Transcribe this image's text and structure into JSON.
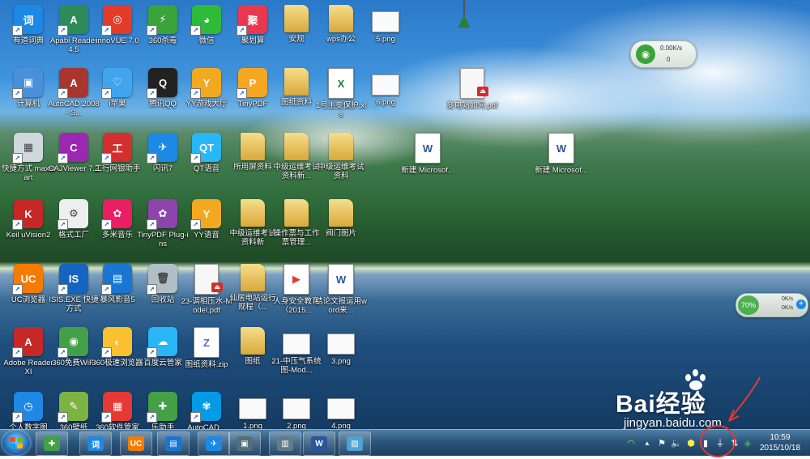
{
  "desktop_icons": [
    {
      "label": "有道词典",
      "color": "#1e88e5",
      "glyph": "词",
      "kind": "app"
    },
    {
      "label": "Apabi Reader 4.5",
      "color": "#2e8b57",
      "glyph": "A",
      "kind": "app"
    },
    {
      "label": "innoVUE 7.0",
      "color": "#e23b2a",
      "glyph": "◎",
      "kind": "app"
    },
    {
      "label": "360杀毒",
      "color": "#3aa33a",
      "glyph": "⚡",
      "kind": "app"
    },
    {
      "label": "微信",
      "color": "#2fbb3a",
      "glyph": "◕",
      "kind": "app"
    },
    {
      "label": "聚划算",
      "color": "#e8384f",
      "glyph": "聚",
      "kind": "app"
    },
    {
      "label": "安规",
      "color": "#e9c46a",
      "glyph": "",
      "kind": "folder"
    },
    {
      "label": "wps办公",
      "color": "#e9c46a",
      "glyph": "",
      "kind": "folder"
    },
    {
      "label": "5.png",
      "color": "#f5f5f5",
      "glyph": "",
      "kind": "img"
    },
    {
      "label": "计算机",
      "color": "#4a90d9",
      "glyph": "▣",
      "kind": "app"
    },
    {
      "label": "AutoCAD 2008 - S...",
      "color": "#a8352e",
      "glyph": "A",
      "kind": "app"
    },
    {
      "label": "i苹果",
      "color": "#41a5ee",
      "glyph": "♡",
      "kind": "app"
    },
    {
      "label": "腾讯QQ",
      "color": "#222222",
      "glyph": "Q",
      "kind": "app"
    },
    {
      "label": "YY游戏大厅",
      "color": "#f2a922",
      "glyph": "Y",
      "kind": "app"
    },
    {
      "label": "TinyPDF",
      "color": "#f5a623",
      "glyph": "P",
      "kind": "app"
    },
    {
      "label": "图纸资料",
      "color": "#e9c46a",
      "glyph": "",
      "kind": "folder"
    },
    {
      "label": "1号主变保护.xls",
      "color": "#1f7a3f",
      "glyph": "X",
      "kind": "doc"
    },
    {
      "label": "6.png",
      "color": "#f5f5f5",
      "glyph": "",
      "kind": "img"
    },
    {
      "label": "变电站如何.pdf",
      "color": "#f0f0f0",
      "glyph": "",
      "kind": "pdf"
    },
    {
      "label": "快捷方式 maxstart",
      "color": "#cfd8dc",
      "glyph": "▦",
      "kind": "app"
    },
    {
      "label": "CAJViewer 7.2",
      "color": "#9c27b0",
      "glyph": "C",
      "kind": "app"
    },
    {
      "label": "工行网银助手",
      "color": "#d32f2f",
      "glyph": "工",
      "kind": "app"
    },
    {
      "label": "闪讯7",
      "color": "#1e88e5",
      "glyph": "✈",
      "kind": "app"
    },
    {
      "label": "QT语音",
      "color": "#29b6f6",
      "glyph": "QT",
      "kind": "app"
    },
    {
      "label": "所用屏资料",
      "color": "#e9c46a",
      "glyph": "",
      "kind": "folder"
    },
    {
      "label": "中级运维考试资料新...",
      "color": "#e9c46a",
      "glyph": "",
      "kind": "folder"
    },
    {
      "label": "中级运维考试资料",
      "color": "#e9c46a",
      "glyph": "",
      "kind": "folder"
    },
    {
      "label": "新建 Microsof...",
      "color": "#2b579a",
      "glyph": "W",
      "kind": "doc"
    },
    {
      "label": "新建 Microsof...",
      "color": "#2b579a",
      "glyph": "W",
      "kind": "doc"
    },
    {
      "label": "Keil uVision2",
      "color": "#c62828",
      "glyph": "K",
      "kind": "app"
    },
    {
      "label": "格式工厂",
      "color": "#eeeeee",
      "glyph": "⚙",
      "kind": "app"
    },
    {
      "label": "多米音乐",
      "color": "#e91e63",
      "glyph": "✿",
      "kind": "app"
    },
    {
      "label": "TinyPDF Plug-ins",
      "color": "#8e44ad",
      "glyph": "✿",
      "kind": "app"
    },
    {
      "label": "YY语音",
      "color": "#f2a922",
      "glyph": "Y",
      "kind": "app"
    },
    {
      "label": "中级运维考试资料新",
      "color": "#e9c46a",
      "glyph": "",
      "kind": "folder"
    },
    {
      "label": "操作票与工作票管理...",
      "color": "#e9c46a",
      "glyph": "",
      "kind": "folder"
    },
    {
      "label": "阀门图片",
      "color": "#e9c46a",
      "glyph": "",
      "kind": "folder"
    },
    {
      "label": "UC浏览器",
      "color": "#f57c00",
      "glyph": "UC",
      "kind": "app"
    },
    {
      "label": "ISIS.EXE 快捷方式",
      "color": "#1565c0",
      "glyph": "IS",
      "kind": "app"
    },
    {
      "label": "暴风影音5",
      "color": "#1976d2",
      "glyph": "▤",
      "kind": "app"
    },
    {
      "label": "回收站",
      "color": "#b0bec5",
      "glyph": "🗑",
      "kind": "app"
    },
    {
      "label": "23-调相压水-Model.pdf",
      "color": "#f0f0f0",
      "glyph": "",
      "kind": "pdf"
    },
    {
      "label": "仙居电站运行规程（...",
      "color": "#e9c46a",
      "glyph": "",
      "kind": "folder"
    },
    {
      "label": "人身安全教育（2015...",
      "color": "#e53935",
      "glyph": "▶",
      "kind": "doc"
    },
    {
      "label": "结论文报运用word来...",
      "color": "#2b579a",
      "glyph": "W",
      "kind": "doc"
    },
    {
      "label": "Adobe Reader XI",
      "color": "#c62828",
      "glyph": "A",
      "kind": "app"
    },
    {
      "label": "360免费WiFi",
      "color": "#43a047",
      "glyph": "◉",
      "kind": "app"
    },
    {
      "label": "360极速浏览器",
      "color": "#fbc02d",
      "glyph": "◐",
      "kind": "app"
    },
    {
      "label": "百度云管家",
      "color": "#29b6f6",
      "glyph": "☁",
      "kind": "app"
    },
    {
      "label": "图纸资料.zip",
      "color": "#5c6bc0",
      "glyph": "Z",
      "kind": "doc"
    },
    {
      "label": "图纸",
      "color": "#e9c46a",
      "glyph": "",
      "kind": "folder"
    },
    {
      "label": "21-中压气系统图-Mod...",
      "color": "#eeeeee",
      "glyph": "",
      "kind": "img"
    },
    {
      "label": "3.png",
      "color": "#f5f5f5",
      "glyph": "",
      "kind": "img"
    },
    {
      "label": "个人数字图",
      "color": "#1e88e5",
      "glyph": "◷",
      "kind": "app"
    },
    {
      "label": "360壁纸",
      "color": "#7cb342",
      "glyph": "✎",
      "kind": "app"
    },
    {
      "label": "360软件管家",
      "color": "#e53935",
      "glyph": "▦",
      "kind": "app"
    },
    {
      "label": "乐助手",
      "color": "#43a047",
      "glyph": "✚",
      "kind": "app"
    },
    {
      "label": "AutoCAD...",
      "color": "#039be5",
      "glyph": "✾",
      "kind": "app"
    },
    {
      "label": "1.png",
      "color": "#f5f5f5",
      "glyph": "",
      "kind": "img"
    },
    {
      "label": "2.png",
      "color": "#f5f5f5",
      "glyph": "",
      "kind": "img"
    },
    {
      "label": "4.png",
      "color": "#f5f5f5",
      "glyph": "",
      "kind": "img"
    }
  ],
  "net_widget_top": {
    "speed_up": "0.00K/s",
    "speed_down": "0"
  },
  "net_widget_right": {
    "percent": "70%",
    "up": "0K/s",
    "down": "0K/s"
  },
  "taskbar": {
    "pinned": [
      {
        "name": "360安全卫士",
        "color": "#43a047",
        "glyph": "✚"
      },
      {
        "name": "有道词典",
        "color": "#1e88e5",
        "glyph": "词"
      },
      {
        "name": "UC浏览器",
        "color": "#f57c00",
        "glyph": "UC"
      },
      {
        "name": "暴风影音",
        "color": "#1976d2",
        "glyph": "▤"
      },
      {
        "name": "闪讯",
        "color": "#1e88e5",
        "glyph": "✈"
      },
      {
        "name": "计算机",
        "color": "#546e7a",
        "glyph": "▣"
      },
      {
        "name": "窗口",
        "color": "#607d8b",
        "glyph": "▥"
      },
      {
        "name": "Word",
        "color": "#2b579a",
        "glyph": "W"
      },
      {
        "name": "图片",
        "color": "#4fa3d1",
        "glyph": "▨"
      }
    ],
    "clock_time": "10:59",
    "clock_date": "2015/10/18"
  },
  "watermark": {
    "logo": "Bai经验",
    "url": "jingyan.baidu.com"
  }
}
